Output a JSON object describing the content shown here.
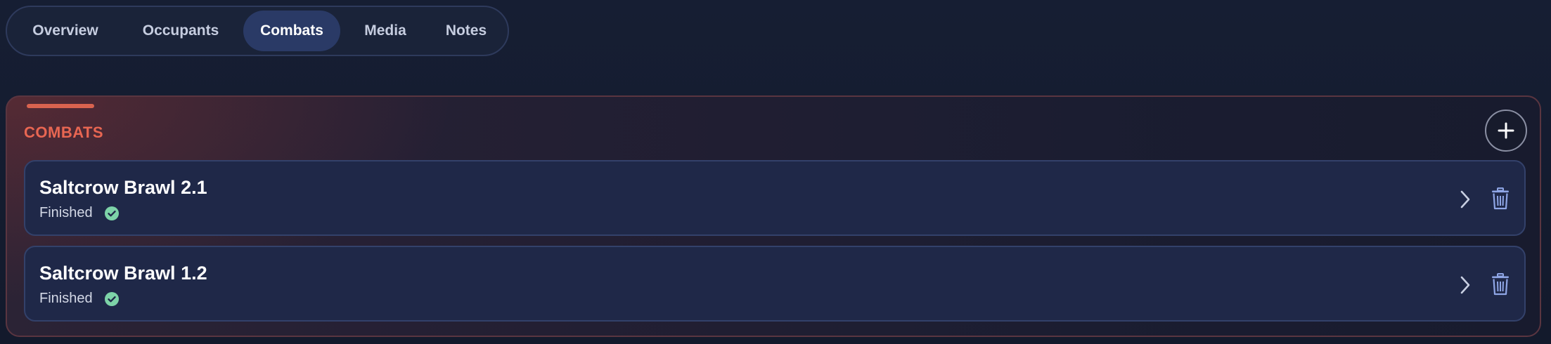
{
  "tabs": [
    {
      "label": "Overview",
      "active": false
    },
    {
      "label": "Occupants",
      "active": false
    },
    {
      "label": "Combats",
      "active": true
    },
    {
      "label": "Media",
      "active": false
    },
    {
      "label": "Notes",
      "active": false
    }
  ],
  "combats_panel": {
    "title": "COMBATS",
    "add_icon": "plus-icon",
    "accent_color": "#d9634f",
    "items": [
      {
        "name": "Saltcrow Brawl 2.1",
        "status": "Finished",
        "status_icon": "check-circle-icon",
        "status_color": "#7dd3a8"
      },
      {
        "name": "Saltcrow Brawl 1.2",
        "status": "Finished",
        "status_icon": "check-circle-icon",
        "status_color": "#7dd3a8"
      }
    ]
  },
  "colors": {
    "background": "#141c30",
    "active_tab": "#2a3a66",
    "card": "#1f2848",
    "title_accent": "#e86652",
    "icon_blue": "#8fa6e6"
  }
}
